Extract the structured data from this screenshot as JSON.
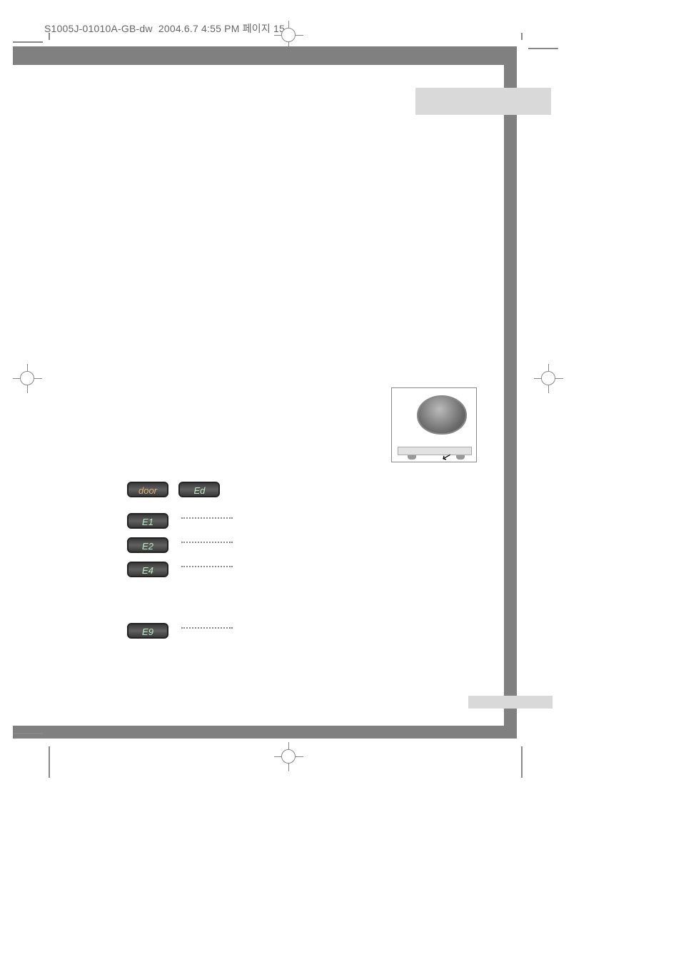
{
  "header": {
    "doc_id": "S1005J-01010A-GB-dw",
    "timestamp": "2004.6.7 4:55 PM",
    "page_marker": "페이지 15"
  },
  "error_codes": {
    "door": "door",
    "ed": "Ed",
    "e1": "E1",
    "e2": "E2",
    "e4": "E4",
    "e9": "E9"
  },
  "icons": {
    "arrow": "↙"
  }
}
